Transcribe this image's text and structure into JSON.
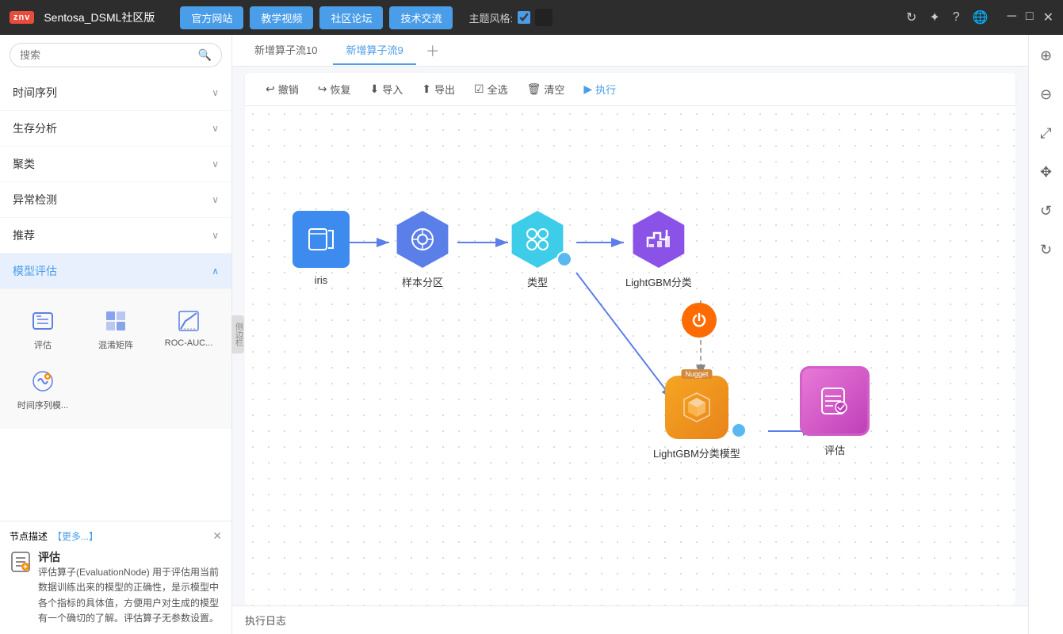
{
  "app": {
    "logo": "znv",
    "title": "Sentosa_DSML社区版"
  },
  "titlebar": {
    "nav_buttons": [
      "官方网站",
      "教学视频",
      "社区论坛",
      "技术交流"
    ],
    "theme_label": "主题风格:",
    "icons": [
      "refresh",
      "settings",
      "help",
      "globe",
      "minimize",
      "maximize",
      "close"
    ]
  },
  "sidebar": {
    "search_placeholder": "搜索",
    "menu_items": [
      {
        "label": "时间序列",
        "expanded": false
      },
      {
        "label": "生存分析",
        "expanded": false
      },
      {
        "label": "聚类",
        "expanded": false
      },
      {
        "label": "异常检测",
        "expanded": false
      },
      {
        "label": "推荐",
        "expanded": false
      },
      {
        "label": "模型评估",
        "expanded": true
      }
    ],
    "sub_items": [
      {
        "label": "评估",
        "icon": "📊"
      },
      {
        "label": "混淆矩阵",
        "icon": "📋"
      },
      {
        "label": "ROC-AUC...",
        "icon": "📈"
      },
      {
        "label": "时间序列模...",
        "icon": "🔧"
      }
    ]
  },
  "node_desc": {
    "header": "节点描述",
    "more": "【更多...】",
    "name": "评估",
    "text": "评估算子(EvaluationNode) 用于评估用当前数据训练出来的模型的正确性，是示模型中各个指标的具体值，方便用户对生成的模型有一个确切的了解。评估算子无参数设置。"
  },
  "tabs": [
    {
      "label": "新增算子流10",
      "active": false
    },
    {
      "label": "新增算子流9",
      "active": true
    }
  ],
  "toolbar": {
    "buttons": [
      {
        "label": "撤销",
        "icon": "↩"
      },
      {
        "label": "恢复",
        "icon": "↪"
      },
      {
        "label": "导入",
        "icon": "⬇"
      },
      {
        "label": "导出",
        "icon": "⬆"
      },
      {
        "label": "全选",
        "icon": "☑"
      },
      {
        "label": "清空",
        "icon": "🗑"
      },
      {
        "label": "执行",
        "icon": "▶"
      }
    ]
  },
  "flow": {
    "nodes": [
      {
        "id": "iris",
        "label": "iris",
        "type": "square"
      },
      {
        "id": "sample",
        "label": "样本分区",
        "type": "hex-blue"
      },
      {
        "id": "type",
        "label": "类型",
        "type": "hex-cyan"
      },
      {
        "id": "lightgbm_cls",
        "label": "LightGBM分类",
        "type": "hex-purple"
      },
      {
        "id": "lightgbm_model",
        "label": "LightGBM分类模型",
        "type": "nugget"
      },
      {
        "id": "eval",
        "label": "评估",
        "type": "eval"
      }
    ]
  },
  "right_panel": {
    "icons": [
      "zoom-in",
      "zoom-out",
      "fit",
      "move",
      "rotate",
      "reset"
    ]
  },
  "bottom": {
    "label": "执行日志"
  }
}
